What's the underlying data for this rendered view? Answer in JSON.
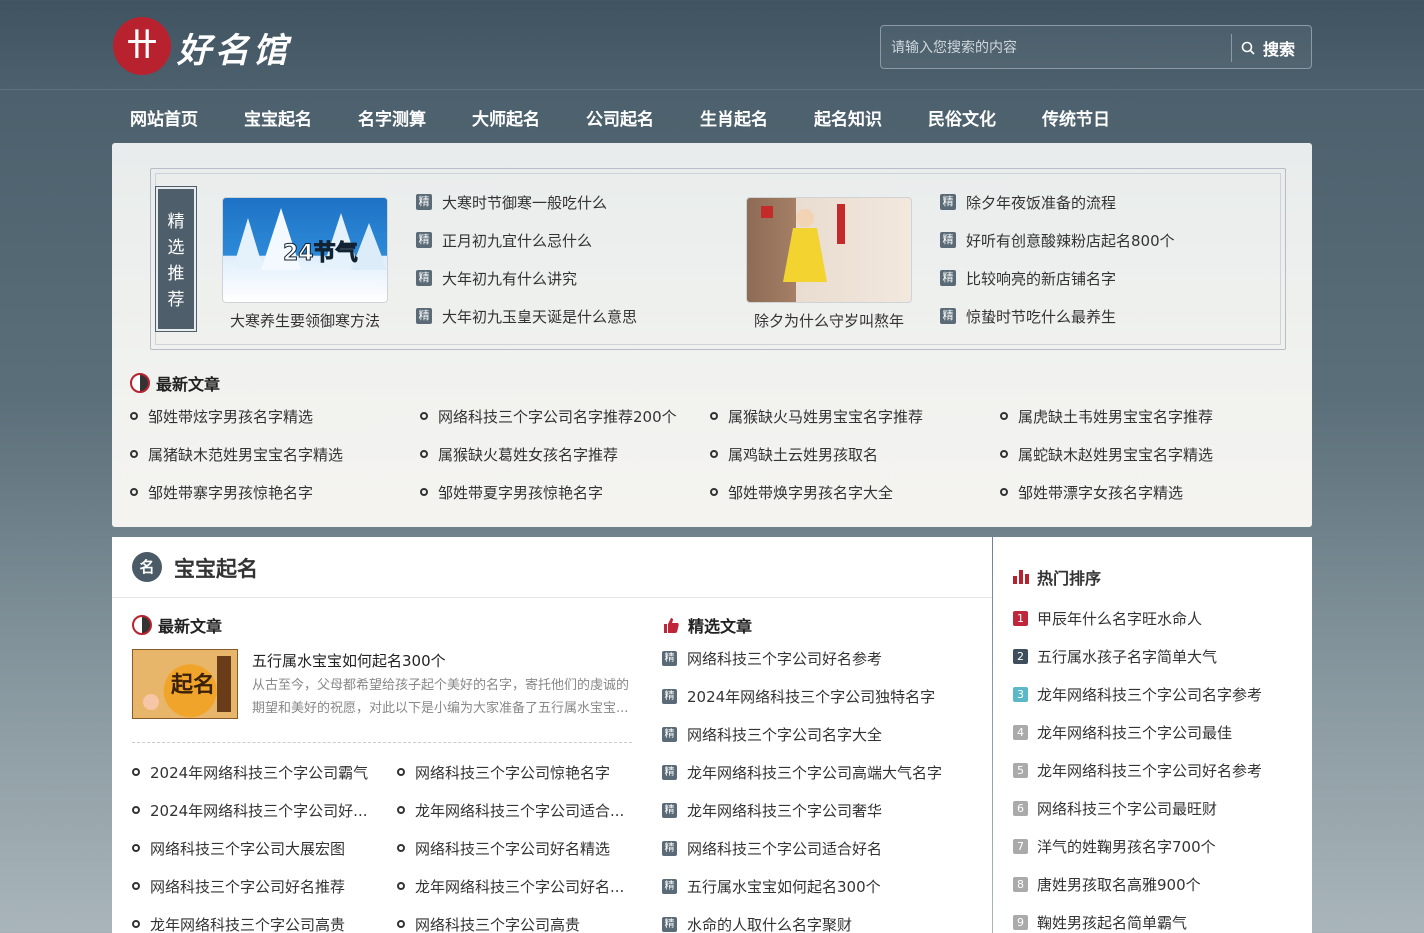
{
  "site": {
    "logo_mark": "卄",
    "logo_text": "好名馆"
  },
  "search": {
    "placeholder": "请输入您搜索的内容",
    "button_label": "搜索"
  },
  "nav": [
    "网站首页",
    "宝宝起名",
    "名字测算",
    "大师起名",
    "公司起名",
    "生肖起名",
    "起名知识",
    "民俗文化",
    "传统节日"
  ],
  "featured": {
    "tag": "精\n选\n推\n荐",
    "badge": "精",
    "block1": {
      "thumb_text": "24节气",
      "caption": "大寒养生要领御寒方法",
      "items": [
        "大寒时节御寒一般吃什么",
        "正月初九宜什么忌什么",
        "大年初九有什么讲究",
        "大年初九玉皇天诞是什么意思"
      ]
    },
    "block2": {
      "caption": "除夕为什么守岁叫熬年",
      "items": [
        "除夕年夜饭准备的流程",
        "好听有创意酸辣粉店起名800个",
        "比较响亮的新店铺名字",
        "惊蛰时节吃什么最养生"
      ]
    },
    "latest_title": "最新文章",
    "latest": [
      "邹姓带炫字男孩名字精选",
      "网络科技三个字公司名字推荐200个",
      "属猴缺火马姓男宝宝名字推荐",
      "属虎缺土韦姓男宝宝名字推荐",
      "属猪缺木范姓男宝宝名字精选",
      "属猴缺火葛姓女孩名字推荐",
      "属鸡缺土云姓男孩取名",
      "属蛇缺木赵姓男宝宝名字精选",
      "邹姓带寨字男孩惊艳名字",
      "邹姓带夏字男孩惊艳名字",
      "邹姓带焕字男孩名字大全",
      "邹姓带漂字女孩名字精选"
    ]
  },
  "baby": {
    "icon": "名",
    "title": "宝宝起名",
    "latest_title": "最新文章",
    "article": {
      "title": "五行属水宝宝如何起名300个",
      "desc": "从古至今，父母都希望给孩子起个美好的名字，寄托他们的虔诚的期望和美好的祝愿，对此以下是小编为大家准备了五行属水宝宝...",
      "thumb_text": "起名"
    },
    "list": [
      "2024年网络科技三个字公司霸气",
      "网络科技三个字公司惊艳名字",
      "2024年网络科技三个字公司好...",
      "龙年网络科技三个字公司适合...",
      "网络科技三个字公司大展宏图",
      "网络科技三个字公司好名精选",
      "网络科技三个字公司好名推荐",
      "龙年网络科技三个字公司好名...",
      "龙年网络科技三个字公司高贵",
      "网络科技三个字公司高贵"
    ],
    "selected_title": "精选文章",
    "selected": [
      "网络科技三个字公司好名参考",
      "2024年网络科技三个字公司独特名字",
      "网络科技三个字公司名字大全",
      "龙年网络科技三个字公司高端大气名字",
      "龙年网络科技三个字公司奢华",
      "网络科技三个字公司适合好名",
      "五行属水宝宝如何起名300个",
      "水命的人取什么名字聚财"
    ]
  },
  "hot": {
    "title": "热门排序",
    "rank_colors": [
      "#c0263a",
      "#3d4f5c",
      "#5bb8c9",
      "#aaaaaa",
      "#aaaaaa",
      "#aaaaaa",
      "#aaaaaa",
      "#aaaaaa",
      "#aaaaaa"
    ],
    "items": [
      {
        "num": "1",
        "text": "甲辰年什么名字旺水命人"
      },
      {
        "num": "2",
        "text": "五行属水孩子名字简单大气"
      },
      {
        "num": "3",
        "text": "龙年网络科技三个字公司名字参考"
      },
      {
        "num": "4",
        "text": "龙年网络科技三个字公司最佳"
      },
      {
        "num": "5",
        "text": "龙年网络科技三个字公司好名参考"
      },
      {
        "num": "6",
        "text": "网络科技三个字公司最旺财"
      },
      {
        "num": "7",
        "text": "洋气的姓鞠男孩名字700个"
      },
      {
        "num": "8",
        "text": "唐姓男孩取名高雅900个"
      },
      {
        "num": "9",
        "text": "鞠姓男孩起名简单霸气"
      }
    ]
  }
}
